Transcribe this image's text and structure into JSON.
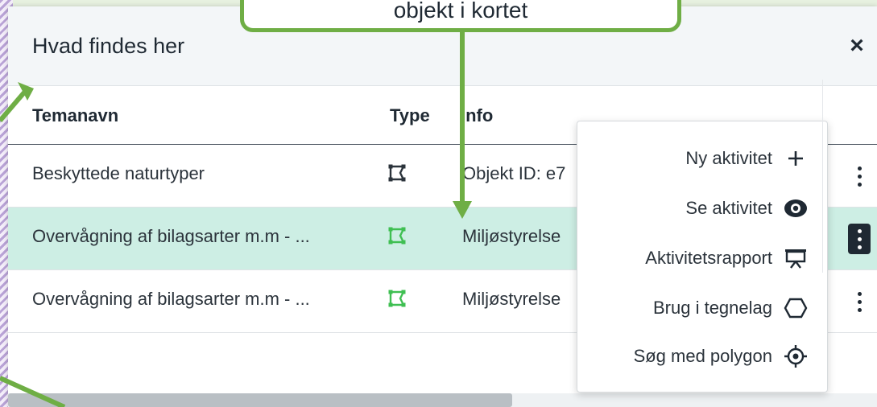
{
  "callout": {
    "text": "objekt i kortet"
  },
  "panel": {
    "title": "Hvad findes her",
    "close_label": "×"
  },
  "table": {
    "headers": {
      "name": "Temanavn",
      "type": "Type",
      "info": "Info"
    },
    "rows": [
      {
        "name": "Beskyttede naturtyper",
        "info": "Objekt ID: e7",
        "type_icon": "polygon-icon",
        "selected": false
      },
      {
        "name": "Overvågning af bilagsarter m.m - ...",
        "info": "Miljøstyrelse",
        "type_icon": "polygon-icon",
        "selected": true
      },
      {
        "name": "Overvågning af bilagsarter m.m - ...",
        "info": "Miljøstyrelse",
        "type_icon": "polygon-icon",
        "selected": false
      }
    ]
  },
  "context_menu": {
    "items": [
      {
        "label": "Ny aktivitet",
        "icon": "plus-icon"
      },
      {
        "label": "Se aktivitet",
        "icon": "eye-icon"
      },
      {
        "label": "Aktivitetsrapport",
        "icon": "presentation-icon"
      },
      {
        "label": "Brug i tegnelag",
        "icon": "hexagon-icon"
      },
      {
        "label": "Søg med polygon",
        "icon": "crosshair-icon"
      }
    ]
  },
  "colors": {
    "accent_green": "#6fae45",
    "selected_row": "#cdeee4",
    "icon_dark": "#2b333b",
    "icon_green": "#3fbf52"
  }
}
